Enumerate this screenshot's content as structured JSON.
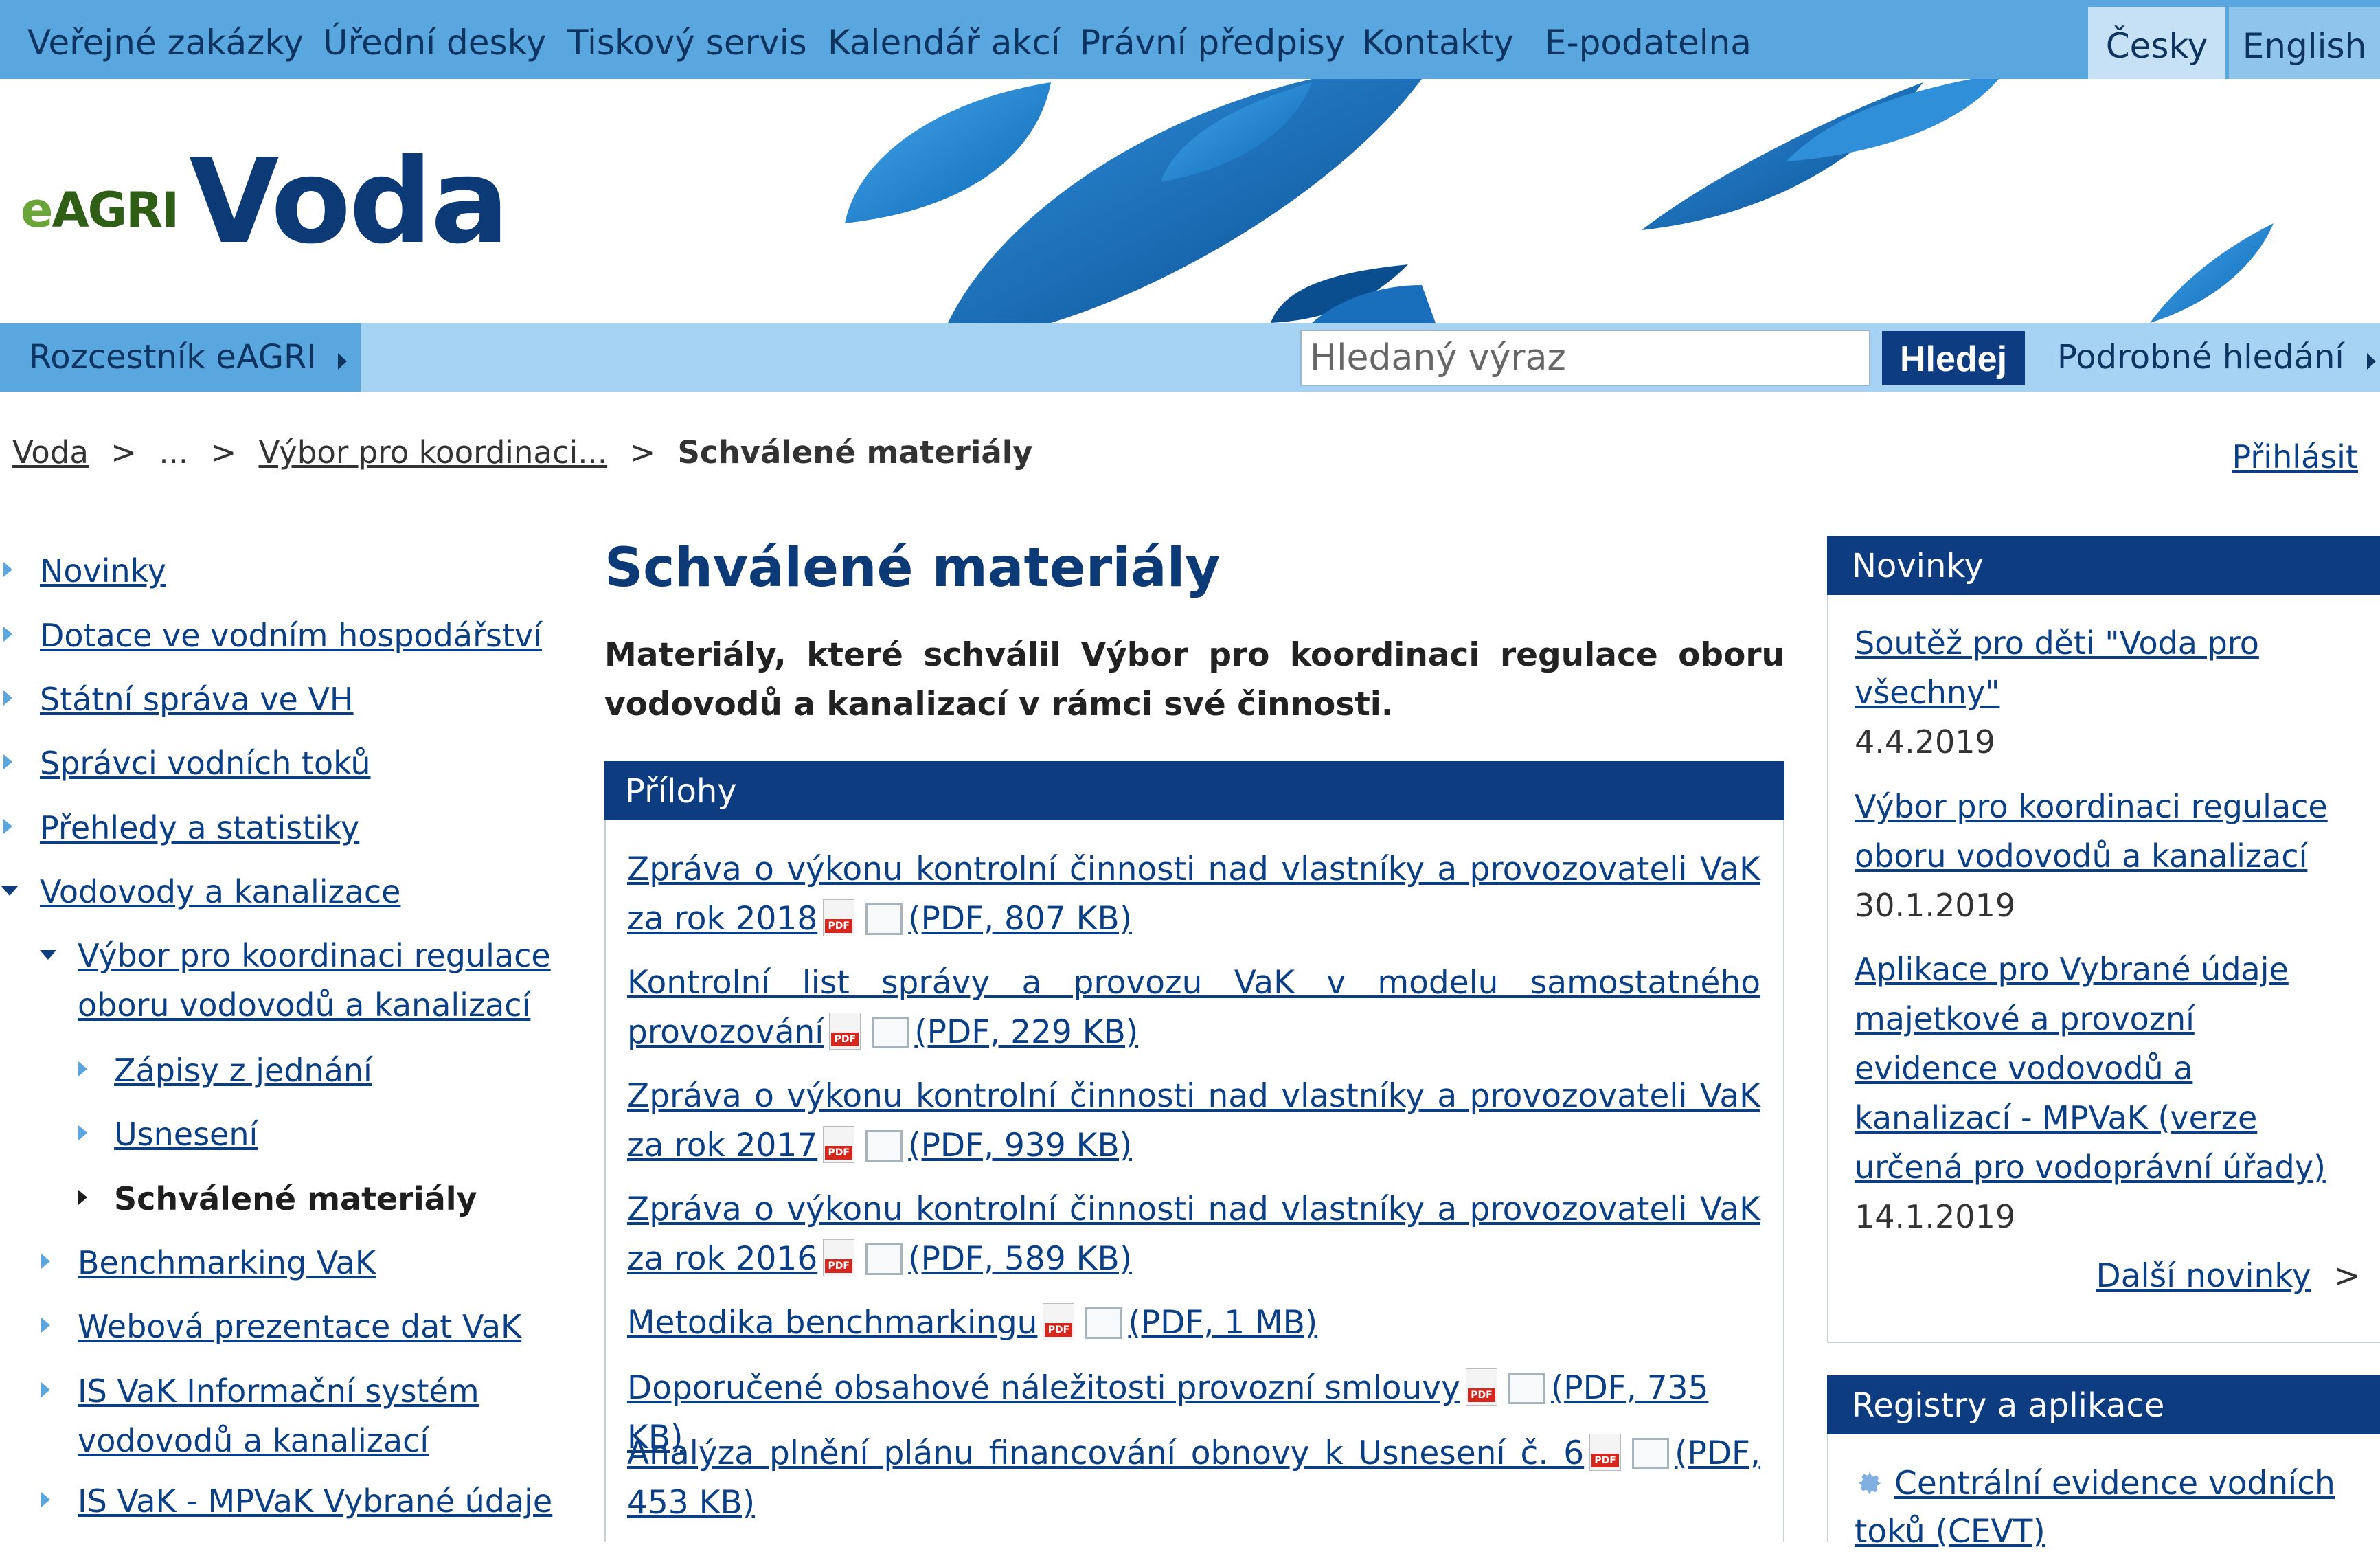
{
  "top_nav": {
    "items": [
      "Veřejné zakázky",
      "Úřední desky",
      "Tiskový servis",
      "Kalendář akcí",
      "Právní předpisy",
      "Kontakty",
      "E-podatelna"
    ],
    "languages": [
      "Česky",
      "English"
    ]
  },
  "header": {
    "logo_prefix": "e",
    "logo_rest": "AGRI",
    "site_title": "Voda"
  },
  "search": {
    "rozcestnik": "Rozcestník eAGRI",
    "placeholder": "Hledaný výraz",
    "button": "Hledej",
    "advanced": "Podrobné hledání"
  },
  "breadcrumb": {
    "items": [
      "Voda",
      "...",
      "Výbor pro koordinaci..."
    ],
    "current": "Schválené materiály",
    "separator": ">"
  },
  "login": "Přihlásit",
  "left_menu": [
    {
      "label": "Novinky"
    },
    {
      "label": "Dotace ve vodním hospodářství"
    },
    {
      "label": "Státní správa ve VH"
    },
    {
      "label": "Správci vodních toků"
    },
    {
      "label": "Přehledy a statistiky"
    },
    {
      "label": "Vodovody a kanalizace"
    },
    {
      "label_line1": "Výbor pro koordinaci regulace",
      "label_line2": "oboru vodovodů a kanalizací"
    },
    {
      "label": "Zápisy z jednání"
    },
    {
      "label": "Usnesení"
    },
    {
      "label": "Schválené materiály"
    },
    {
      "label": "Benchmarking VaK"
    },
    {
      "label": "Webová prezentace dat VaK"
    },
    {
      "label_line1": "IS VaK Informační systém",
      "label_line2": "vodovodů a kanalizací"
    },
    {
      "label": "IS VaK - MPVaK Vybrané údaje"
    }
  ],
  "main": {
    "title": "Schválené materiály",
    "intro": "Materiály, které schválil Výbor pro koordinaci regulace oboru vodovodů a kanalizací v rámci své činnosti.",
    "attachments_heading": "Přílohy",
    "attachments": [
      {
        "title": "Zpráva o výkonu kontrolní činnosti nad vlastníky a provozovateli VaK za rok 2018",
        "meta": "(PDF, 807 KB)"
      },
      {
        "title": "Kontrolní list správy a provozu VaK v modelu samostatného provozování",
        "meta": "(PDF, 229 KB)"
      },
      {
        "title": "Zpráva o výkonu kontrolní činnosti nad vlastníky a provozovateli VaK za rok 2017",
        "meta": "(PDF, 939 KB)"
      },
      {
        "title": "Zpráva o výkonu kontrolní činnosti nad vlastníky a provozovateli VaK za rok 2016",
        "meta": "(PDF, 589 KB)"
      },
      {
        "title": "Metodika benchmarkingu",
        "meta": "(PDF, 1 MB)"
      },
      {
        "title": "Doporučené obsahové náležitosti provozní smlouvy",
        "meta": "(PDF, 735 KB)"
      },
      {
        "title": "Analýza plnění plánu financování obnovy k Usnesení č. 6",
        "meta": "(PDF, 453 KB)"
      }
    ]
  },
  "news": {
    "heading": "Novinky",
    "items": [
      {
        "title": "Soutěž pro děti \"Voda pro všechny\"",
        "date": "4.4.2019"
      },
      {
        "title": "Výbor pro koordinaci regulace oboru vodovodů a kanalizací",
        "date": "30.1.2019"
      },
      {
        "title": "Aplikace pro Vybrané údaje majetkové a provozní evidence vodovodů a kanalizací - MPVaK (verze určená pro vodoprávní úřady)",
        "date": "14.1.2019"
      }
    ],
    "more": "Další novinky",
    "more_arrow": ">"
  },
  "registries": {
    "heading": "Registry a aplikace",
    "items": [
      {
        "label": "Centrální evidence vodních toků (CEVT)",
        "icon": "gear-icon"
      }
    ]
  },
  "colors": {
    "nav_blue": "#5aa6df",
    "search_bar": "#a6d3f3",
    "dark_blue": "#0d3d80",
    "link": "#0a3f86"
  }
}
